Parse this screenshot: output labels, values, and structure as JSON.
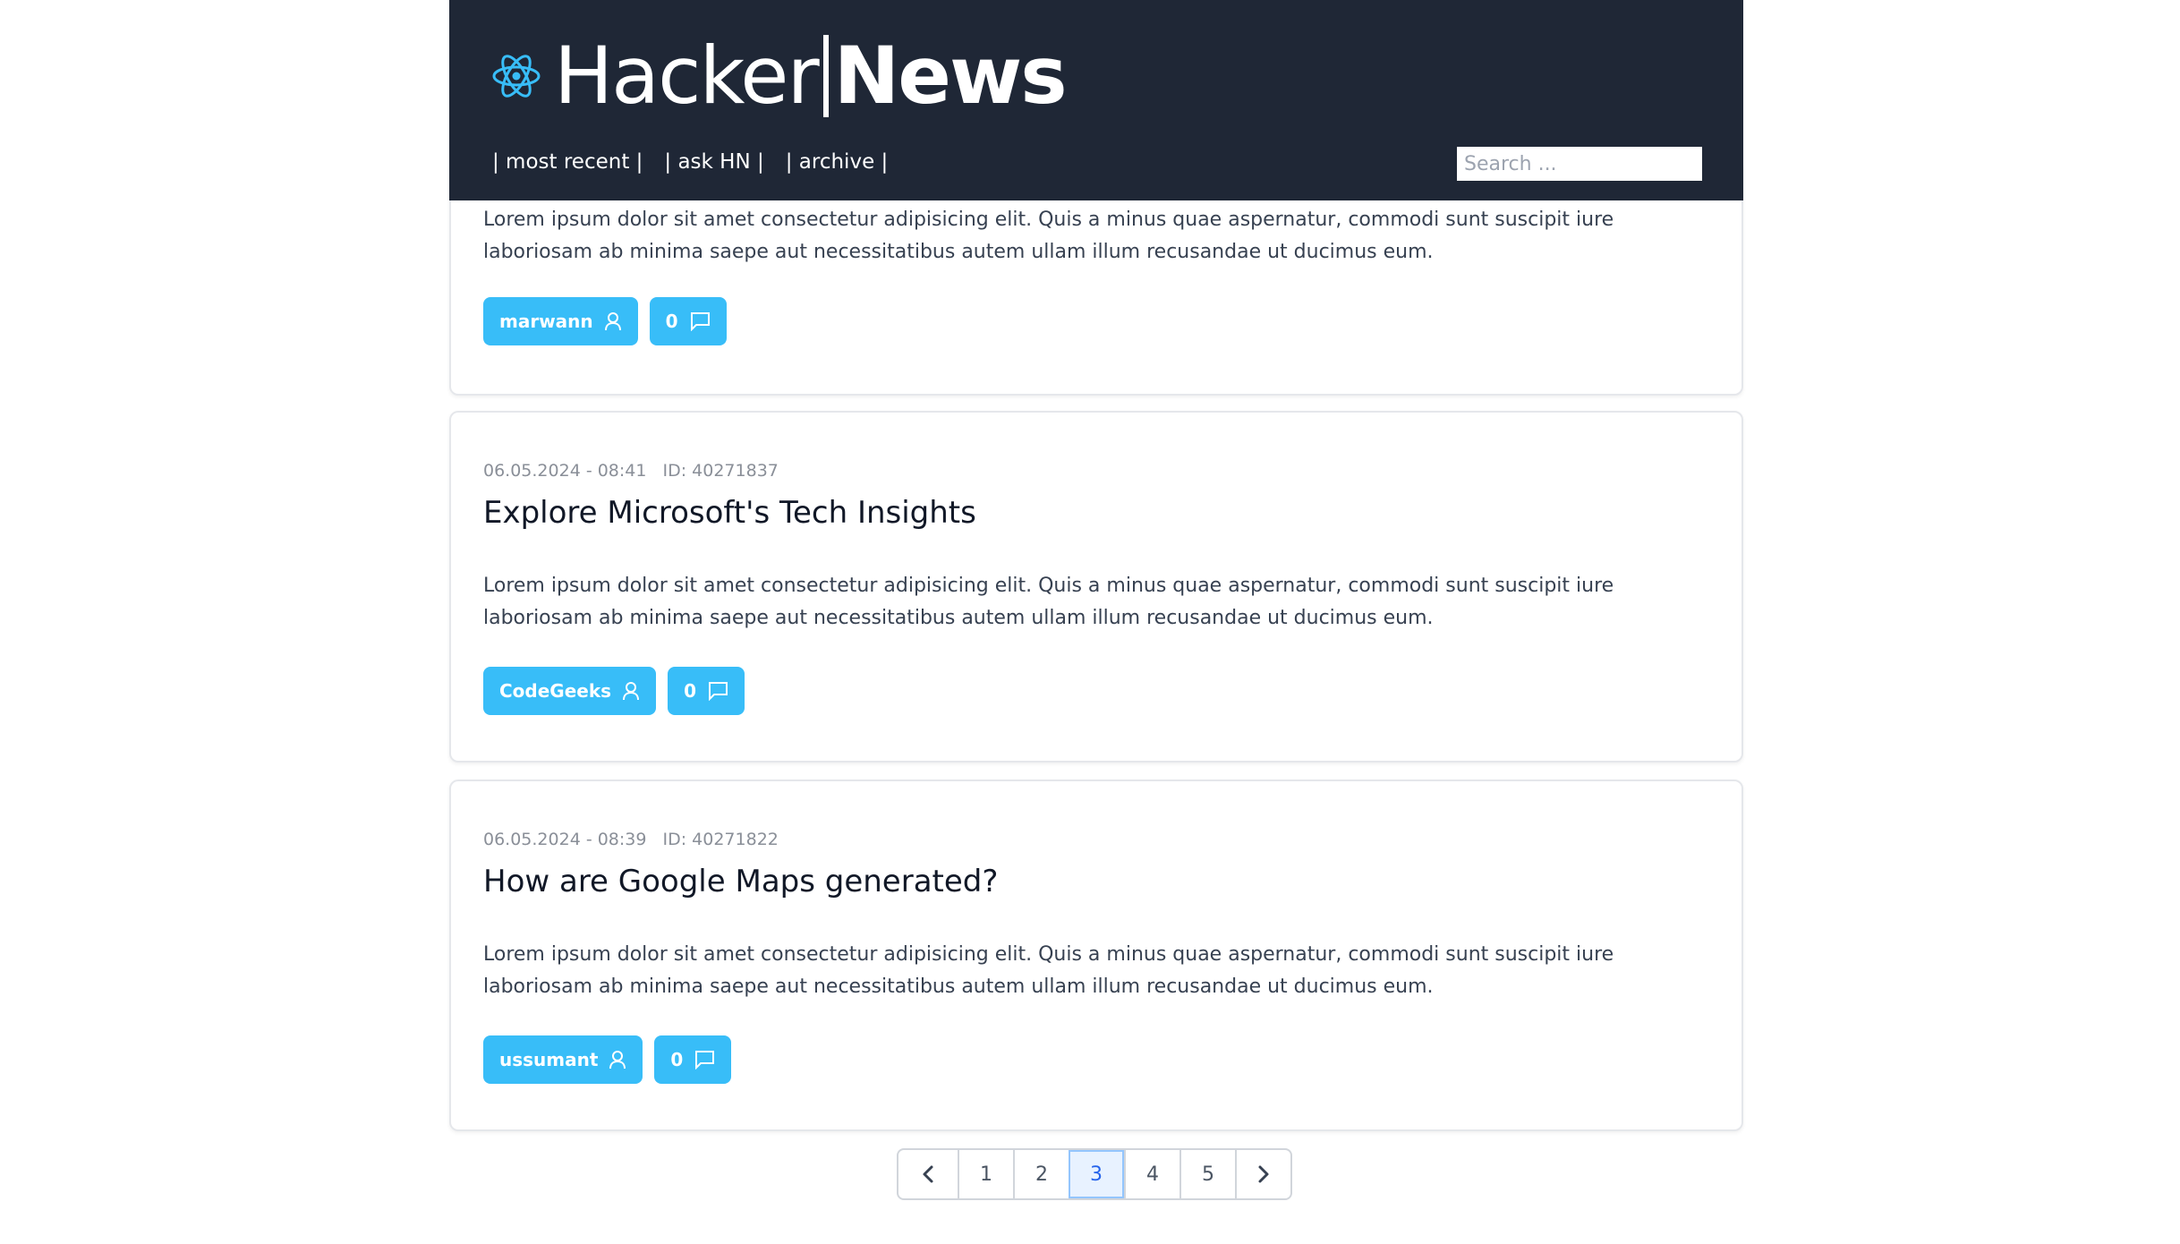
{
  "header": {
    "logo_hacker": "Hacker",
    "logo_news": "News",
    "nav": [
      {
        "label": "| most recent |"
      },
      {
        "label": "| ask HN |"
      },
      {
        "label": "| archive |"
      }
    ],
    "search_placeholder": "Search ..."
  },
  "colors": {
    "header_bg": "#1f2736",
    "accent": "#38bdf8",
    "active_page": "#2563eb"
  },
  "posts": [
    {
      "body": "Lorem ipsum dolor sit amet consectetur adipisicing elit. Quis a minus quae aspernatur, commodi sunt suscipit iure laboriosam ab minima saepe aut necessitatibus autem ullam illum recusandae ut ducimus eum.",
      "author": "marwann",
      "comments": "0"
    },
    {
      "date": "06.05.2024 - 08:41",
      "id": "ID: 40271837",
      "title": "Explore Microsoft's Tech Insights",
      "body": "Lorem ipsum dolor sit amet consectetur adipisicing elit. Quis a minus quae aspernatur, commodi sunt suscipit iure laboriosam ab minima saepe aut necessitatibus autem ullam illum recusandae ut ducimus eum.",
      "author": "CodeGeeks",
      "comments": "0"
    },
    {
      "date": "06.05.2024 - 08:39",
      "id": "ID: 40271822",
      "title": "How are Google Maps generated?",
      "body": "Lorem ipsum dolor sit amet consectetur adipisicing elit. Quis a minus quae aspernatur, commodi sunt suscipit iure laboriosam ab minima saepe aut necessitatibus autem ullam illum recusandae ut ducimus eum.",
      "author": "ussumant",
      "comments": "0"
    }
  ],
  "pagination": {
    "pages": [
      "1",
      "2",
      "3",
      "4",
      "5"
    ],
    "current": "3"
  }
}
